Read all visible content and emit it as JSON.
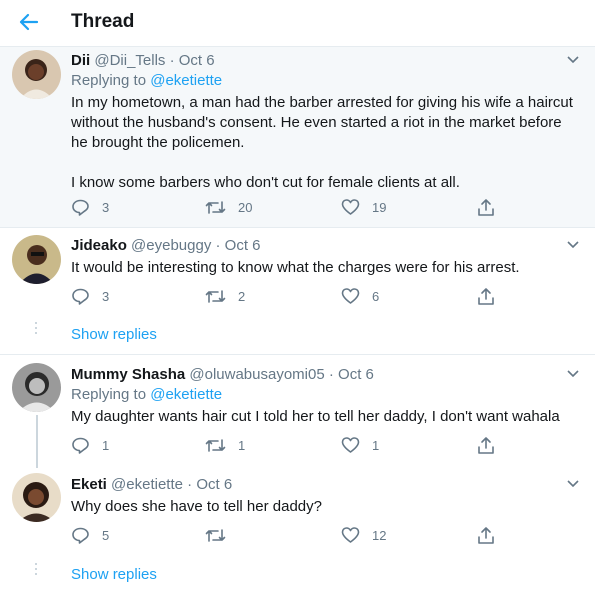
{
  "header": {
    "title": "Thread",
    "back_icon": "arrow-left-icon"
  },
  "colors": {
    "accent": "#1da1f2",
    "muted": "#657786",
    "text": "#14171a"
  },
  "tweets": [
    {
      "name": "Dii",
      "handle": "@Dii_Tells",
      "dot": "·",
      "time": "Oct 6",
      "replying_label": "Replying to",
      "replying_to": "@eketiette",
      "text1": "In my hometown, a man had the barber arrested for giving his wife a haircut without the husband's consent. He even started a riot in the market before he brought the policemen.",
      "text2": "I know some barbers who don't cut for female clients at all.",
      "replies": "3",
      "retweets": "20",
      "likes": "19"
    },
    {
      "name": "Jideako",
      "handle": "@eyebuggy",
      "dot": "·",
      "time": "Oct 6",
      "text1": "It would be interesting to know what the charges were for his arrest.",
      "replies": "3",
      "retweets": "2",
      "likes": "6"
    },
    {
      "name": "Mummy Shasha",
      "handle": "@oluwabusayomi05",
      "dot": "·",
      "time": "Oct 6",
      "replying_label": "Replying to",
      "replying_to": "@eketiette",
      "text1": "My daughter wants hair cut I told her to tell her daddy, I don't want wahala",
      "replies": "1",
      "retweets": "1",
      "likes": "1"
    },
    {
      "name": "Eketi",
      "handle": "@eketiette",
      "dot": "·",
      "time": "Oct 6",
      "text1": "Why does she have to tell her daddy?",
      "replies": "5",
      "retweets": "",
      "likes": "12"
    }
  ],
  "show_replies": [
    "Show replies",
    "Show replies"
  ]
}
